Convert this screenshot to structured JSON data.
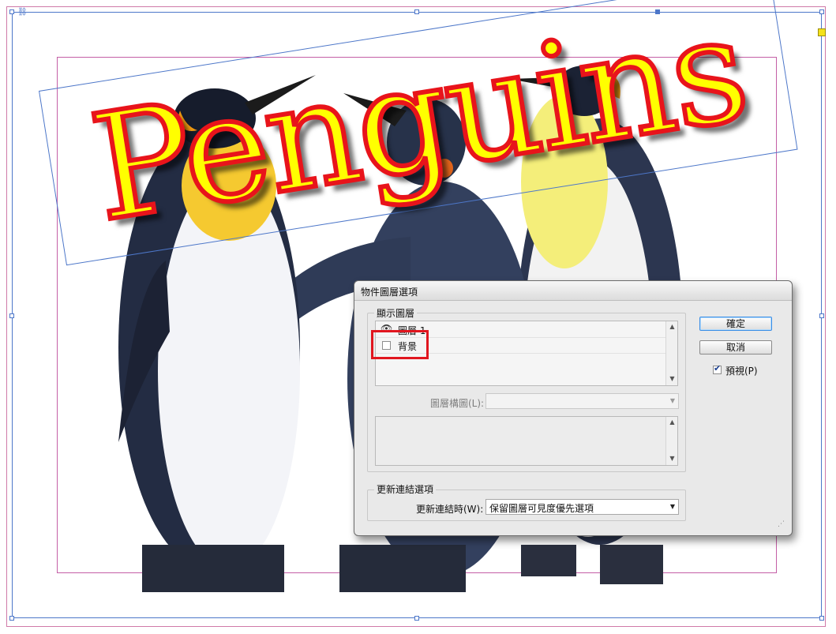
{
  "canvas": {
    "headline": "Penguins",
    "image_subject": "three-penguins-photo"
  },
  "dialog": {
    "title": "物件圖層選項",
    "show_layers_group": "顯示圖層",
    "layers": [
      {
        "name": "圖層 1",
        "visible": true
      },
      {
        "name": "背景",
        "visible": false
      }
    ],
    "layer_comp_label": "圖層構圖(L):",
    "layer_comp_value": "",
    "update_group": "更新連結選項",
    "update_label": "更新連結時(W):",
    "update_value": "保留圖層可見度優先選項",
    "ok_label": "確定",
    "cancel_label": "取消",
    "preview_label": "預視(P)",
    "preview_checked": true
  },
  "colors": {
    "headline_fill": "#ffff00",
    "headline_stroke": "#e8141b",
    "highlight": "#e1161f",
    "frame_blue": "#4d77c9",
    "frame_magenta": "#c45fa6"
  }
}
